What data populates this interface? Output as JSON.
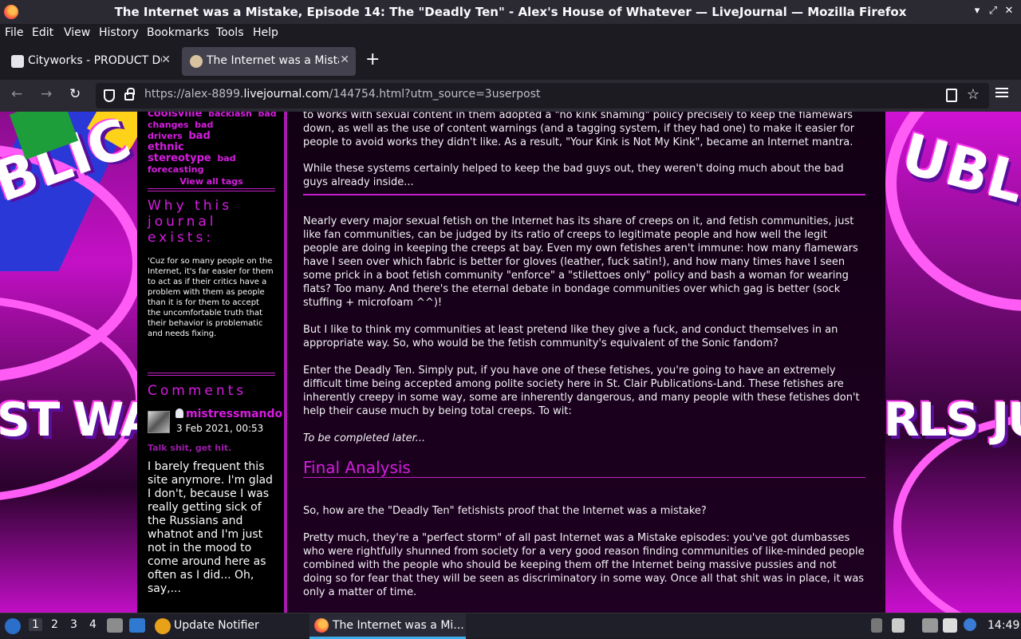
{
  "window": {
    "title": "The Internet was a Mistake, Episode 14: The \"Deadly Ten\" - Alex's House of Whatever — LiveJournal — Mozilla Firefox",
    "controls": {
      "minimize": "▾",
      "restore": "⤢",
      "close": "✕"
    }
  },
  "menu": [
    "File",
    "Edit",
    "View",
    "History",
    "Bookmarks",
    "Tools",
    "Help"
  ],
  "tabs": [
    {
      "label": "Cityworks - PRODUCT DO",
      "active": false,
      "close": "✕"
    },
    {
      "label": "The Internet was a Mista",
      "active": true,
      "close": "✕"
    }
  ],
  "newtab": "+",
  "nav": {
    "back": "←",
    "forward": "→",
    "reload": "↻",
    "url_prefix": "https://alex-8899.",
    "url_domain": "livejournal.com",
    "url_suffix": "/144754.html?utm_source=3userpost",
    "star": "☆"
  },
  "sidebar": {
    "tags_line1": "coolsville",
    "tags_line1b": "backlash",
    "tags_line1c": "bad",
    "tags_line2": "changes",
    "tags_line2b": "bad drivers",
    "tags_line2c": "bad",
    "tags_line3": "ethnic stereotype",
    "tags_line3b": "bad",
    "tags_line4": "forecasting",
    "view_all": "View all tags",
    "why_heading": "Why this journal exists:",
    "why_text": "'Cuz for so many people on the Internet, it's far easier for them to act as if their critics have a problem with them as people than it is for them to accept the uncomfortable truth that their behavior is problematic and needs fixing.",
    "comments_heading": "Comments",
    "comment": {
      "user": "mistressmando",
      "date": "3 Feb 2021, 00:53",
      "subject": "Talk shit, get hit.",
      "body": "I barely frequent this site anymore. I'm glad I don't, because I was really getting sick of the Russians and whatnot and I'm just not in the mood to come around here as often as I did... Oh, say,..."
    }
  },
  "main": {
    "p0": "to works with sexual content in them adopted a \"no kink shaming\" policy precisely to keep the flamewars down, as well as the use of content warnings (and a tagging system, if they had one) to make it easier for people to avoid works they didn't like. As a result, \"Your Kink is Not My Kink\", became an Internet mantra.",
    "p1": "While these systems certainly helped to keep the bad guys out, they weren't doing much about the bad guys already inside...",
    "p2": "Nearly every major sexual fetish on the Internet has its share of creeps on it, and fetish communities, just like fan communities, can be judged by its ratio of creeps to legitimate people and how well the legit people are doing in keeping the creeps at bay. Even my own fetishes aren't immune: how many flamewars have I seen over which fabric is better for gloves (leather, fuck satin!), and how many times have I seen some prick in a boot fetish community \"enforce\" a \"stilettoes only\" policy and bash a woman for wearing flats? Too many. And there's the eternal debate in bondage communities over which gag is better (sock stuffing + microfoam ^^)!",
    "p3": "But I like to think my communities at least pretend like they give a fuck, and conduct themselves in an appropriate way. So, who would be the fetish community's equivalent of the Sonic fandom?",
    "p4": "Enter the Deadly Ten. Simply put, if you have one of these fetishes, you're going to have an extremely difficult time being accepted among polite society here in St. Clair Publications-Land. These fetishes are inherently creepy in some way, some are inherently dangerous, and many people with these fetishes don't help their cause much by being total creeps. To wit:",
    "p5": "To be completed later...",
    "h_final": "Final Analysis",
    "p6": "So, how are the \"Deadly Ten\" fetishists proof that the Internet was a mistake?",
    "p7": "Pretty much, they're a \"perfect storm\" of all past Internet was a Mistake episodes: you've got dumbasses who were rightfully shunned from society for a very good reason finding communities of like-minded people combined with the people who should be keeping them off the Internet being massive pussies and not doing so for fear that they will be seen as discriminatory in some way. Once all that shit was in place, it was only a matter of time."
  },
  "background": {
    "left_text_top": "BLIC",
    "left_text_bottom": "ST WANT",
    "right_text_top": "UBL",
    "right_text_bottom": "RLS JUS"
  },
  "taskbar": {
    "desktops": [
      "1",
      "2",
      "3",
      "4"
    ],
    "update_notifier": "Update Notifier",
    "active_window": "The Internet was a Mi...",
    "clock": "14:49"
  }
}
